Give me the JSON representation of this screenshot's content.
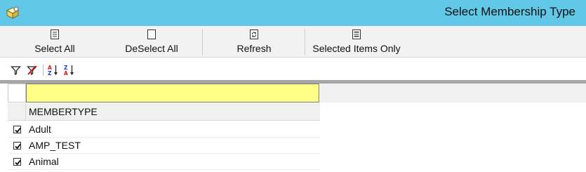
{
  "window": {
    "title": "Select Membership Type",
    "icon": "app-box-icon"
  },
  "ribbon": {
    "buttons": [
      {
        "label": "Select All",
        "icon": "select-all-icon"
      },
      {
        "label": "DeSelect All",
        "icon": "deselect-all-icon"
      },
      {
        "label": "Refresh",
        "icon": "refresh-icon"
      },
      {
        "label": "Selected Items Only",
        "icon": "selected-items-only-icon"
      }
    ]
  },
  "toolbar": {
    "icons": [
      "filter-icon",
      "clear-filter-icon",
      "sort-ascending-icon",
      "sort-descending-icon"
    ]
  },
  "grid": {
    "filter_value": "",
    "column": "MEMBERTYPE",
    "rows": [
      {
        "checked": true,
        "value": "Adult"
      },
      {
        "checked": true,
        "value": "AMP_TEST"
      },
      {
        "checked": true,
        "value": "Animal"
      }
    ]
  },
  "colors": {
    "title_bar": "#62c8e8",
    "filter_row": "#ffff88",
    "splitter": "#a6a6a6"
  }
}
